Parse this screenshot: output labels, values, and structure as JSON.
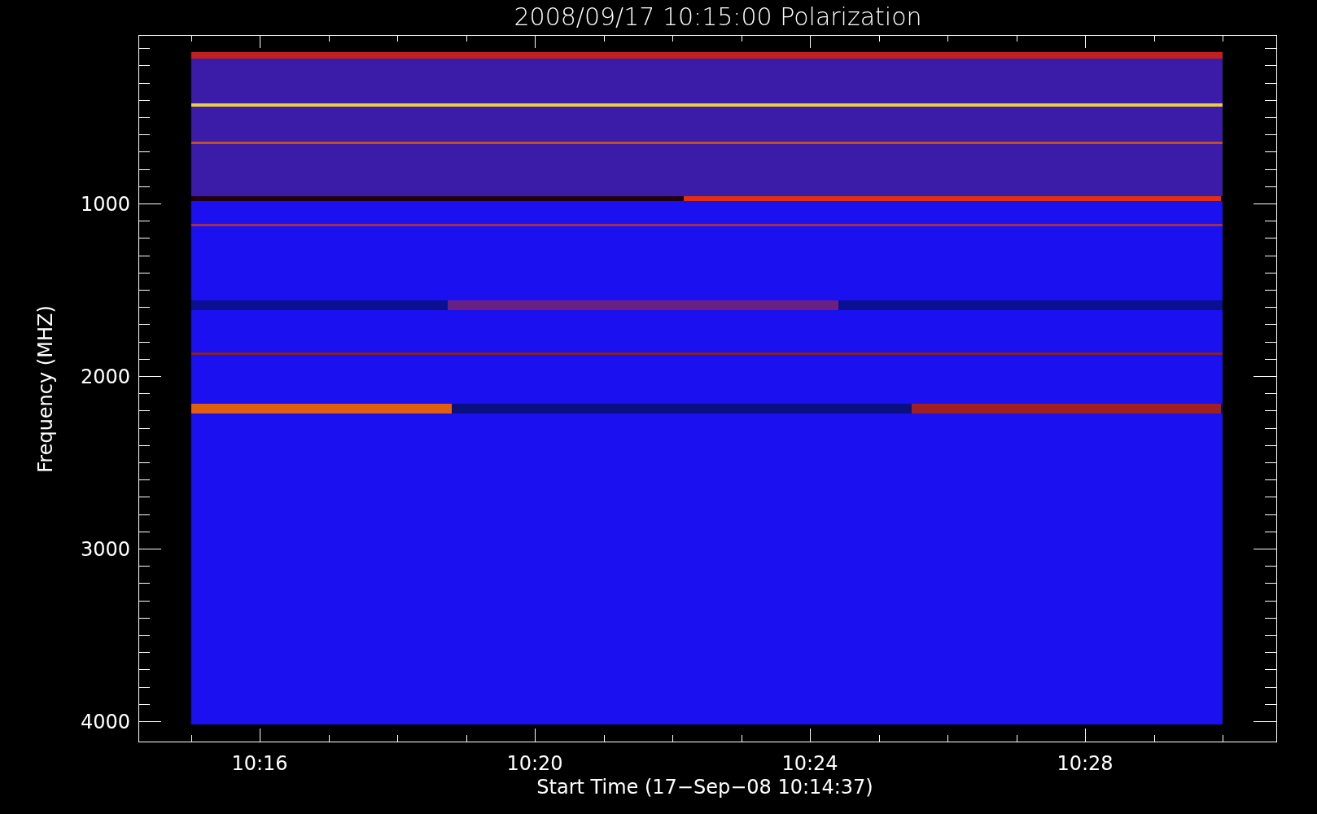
{
  "title": "2008/09/17 10:15:00 Polarization",
  "x_axis": {
    "label": "Start Time (17−Sep−08 10:14:37)",
    "ticks": [
      "10:16",
      "10:20",
      "10:24",
      "10:28"
    ]
  },
  "y_axis": {
    "label": "Frequency (MHZ)",
    "ticks": [
      "1000",
      "2000",
      "3000",
      "4000"
    ]
  }
}
